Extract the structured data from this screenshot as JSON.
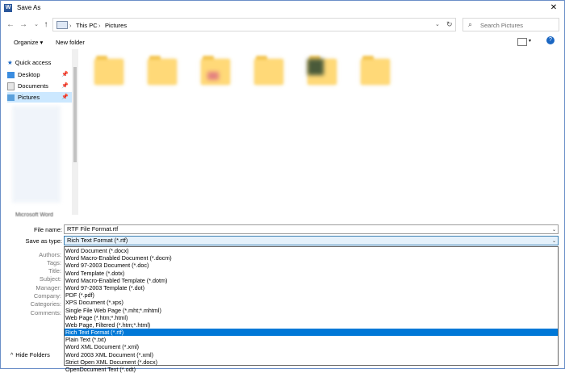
{
  "window": {
    "title": "Save As",
    "close_glyph": "✕"
  },
  "address": {
    "crumbs": [
      "This PC",
      "Pictures"
    ],
    "separator": "›"
  },
  "search": {
    "placeholder": "Search Pictures"
  },
  "toolbar": {
    "organize": "Organize ▾",
    "new_folder": "New folder"
  },
  "nav": {
    "quick_access": "Quick access",
    "items": [
      {
        "label": "Desktop",
        "icon": "desktop-icon",
        "pinned": true
      },
      {
        "label": "Documents",
        "icon": "documents-icon",
        "pinned": true
      },
      {
        "label": "Pictures",
        "icon": "pictures-icon",
        "pinned": true,
        "selected": true
      }
    ],
    "bottom_item": "Microsoft Word"
  },
  "form": {
    "file_name_label": "File name:",
    "file_name_value": "RTF File Format.rtf",
    "save_type_label": "Save as type:",
    "save_type_value": "Rich Text Format (*.rtf)"
  },
  "meta_labels": [
    "Authors:",
    "Tags:",
    "Title:",
    "Subject:",
    "Manager:",
    "Company:",
    "Categories:",
    "Comments:"
  ],
  "type_options": [
    "Word Document (*.docx)",
    "Word Macro-Enabled Document (*.docm)",
    "Word 97-2003 Document (*.doc)",
    "Word Template (*.dotx)",
    "Word Macro-Enabled Template (*.dotm)",
    "Word 97-2003 Template (*.dot)",
    "PDF (*.pdf)",
    "XPS Document (*.xps)",
    "Single File Web Page (*.mht;*.mhtml)",
    "Web Page (*.htm;*.html)",
    "Web Page, Filtered (*.htm;*.html)",
    "Rich Text Format (*.rtf)",
    "Plain Text (*.txt)",
    "Word XML Document (*.xml)",
    "Word 2003 XML Document (*.xml)",
    "Strict Open XML Document (*.docx)",
    "OpenDocument Text (*.odt)"
  ],
  "selected_type_index": 11,
  "hide_folders": "Hide Folders",
  "colors": {
    "selection": "#0078d7",
    "nav_selected": "#cce8ff",
    "folder": "#ffd978",
    "focus_border": "#3c7fb1"
  }
}
